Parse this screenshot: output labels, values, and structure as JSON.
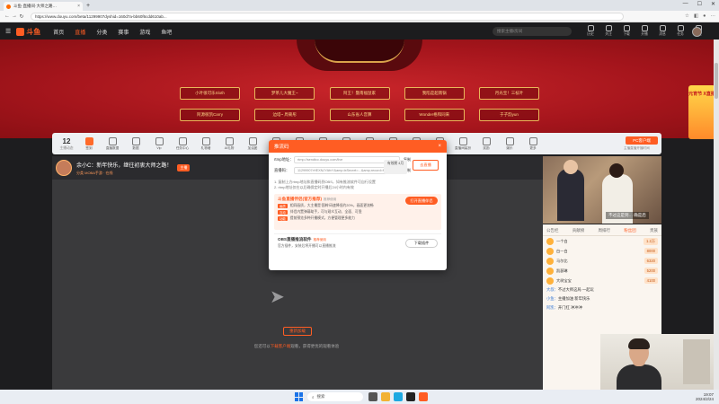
{
  "browser": {
    "tab_title": "斗鱼·直播间·大师之路…",
    "url": "https://www.douyu.com/beta/11299907dyshid=160d7a-bb60f6cdd610ab... ",
    "tab_close": "×",
    "new_tab": "+"
  },
  "header": {
    "logo": "斗鱼",
    "nav": [
      "首页",
      "直播",
      "分类",
      "赛事",
      "游戏",
      "鱼吧"
    ],
    "search_placeholder": "搜索主播/房间",
    "icons": [
      {
        "label": "历史",
        "icon": "history-icon"
      },
      {
        "label": "关注",
        "icon": "follow-icon"
      },
      {
        "label": "下载",
        "icon": "download-icon"
      },
      {
        "label": "开播",
        "icon": "broadcast-icon"
      },
      {
        "label": "消息",
        "icon": "message-icon"
      },
      {
        "label": "任务",
        "icon": "task-icon"
      },
      {
        "label": "设置",
        "icon": "settings-icon"
      }
    ]
  },
  "banner": {
    "row1": [
      "小叶很可乐Sloth",
      "梦茶儿大魔王~",
      "阿王！暨南福鼠家",
      "我陷是超南锅",
      "月光宝！三枝叶"
    ],
    "row2": [
      "阿源很凯Carry",
      "边塔~ 周菊彤",
      "山东省人音算",
      "Wonder格和同来",
      "于子韵yun"
    ],
    "side_promo": "元宵节 X直播"
  },
  "toolbar": {
    "count": "12",
    "count_label": "主播动态",
    "items": [
      "签到",
      "直播数据",
      "数据",
      "Vip",
      "任务中心",
      "礼物墙",
      "AI礼物",
      "加油团",
      "工商",
      "主播认证",
      "粉丝设置",
      "互动",
      "活动",
      "鲨鱼",
      "贡献",
      "主播排行",
      "直播间装扮",
      "奖励",
      "娱乐",
      "更多"
    ],
    "pc_button": "PC客户端",
    "pc_sub": "主播直播开播时间"
  },
  "streamer": {
    "title": "余小C：新年快乐，继往初衷大师之路！",
    "tag": "主播",
    "sub": "分类 MOBA手游 · 在线"
  },
  "player": {
    "load_button": "重新加载",
    "tip_prefix": "您还可以",
    "tip_link": "下载客户端",
    "tip_suffix": "观看，获得更优的观看体验"
  },
  "right_video": {
    "caption": "不过这是到… 确是后"
  },
  "chat": {
    "tabs": [
      "公告栏",
      "贡献榜",
      "周排行",
      "粉丝团",
      "贵族"
    ],
    "ranks": [
      {
        "name": "一个白",
        "value": "1.2万"
      },
      {
        "name": "白一白",
        "value": "8000"
      },
      {
        "name": "马尔比",
        "value": "6320"
      },
      {
        "name": "凯瑟琳",
        "value": "5200"
      },
      {
        "name": "大树宝宝",
        "value": "4100"
      }
    ],
    "lines": [
      {
        "name": "大叔：",
        "text": "不过大师这局 一起玩"
      },
      {
        "name": "小鱼：",
        "text": "主播加油 新年快乐"
      },
      {
        "name": "阿凯：",
        "text": "开门红 冲冲冲"
      }
    ]
  },
  "modal": {
    "title": "推流码",
    "close": "×",
    "rtmp_label": "rtmp地址：",
    "rtmp_value": "rtmp://sendtcc.douyu.com/live",
    "code_label": "直播码：",
    "code_value": "11299907rHEXNJYAfvY&amp;txSecret=...&amp;record=flv&amp;origin=tct",
    "copy": "复制",
    "timebox": "有效期 4月",
    "live_button": "去直播",
    "notes": [
      "1. 复制上方rtmp地址和直播码到OBS，如有推流软件可自行设置",
      "2. rtmp地址仅在以后确保定时开播后24小时内有效"
    ],
    "box1_title": "斗鱼直播伴侣(官方推荐)",
    "box1_tag": "推荐使用",
    "box1_button": "打开直播伴侣",
    "features": [
      {
        "tag": "画质",
        "text": "相同画质，大主播是‘国粹’码速降低约20%，画面更流畅"
      },
      {
        "tag": "互动",
        "text": "伴侣内置弹幕助手，可与观众互动、全面、可靠"
      },
      {
        "tag": "功能",
        "text": "提前预览多种开播模式，方便管理更多能力"
      }
    ],
    "box2_title": "OBS直播推流软件",
    "box2_tag": "推荐使用",
    "box2_desc": "官方插件，安装后将开播可以直播推流",
    "box2_button": "下载插件"
  },
  "taskbar": {
    "search": "搜索",
    "time": "19:07",
    "date": "2024/2/24"
  }
}
